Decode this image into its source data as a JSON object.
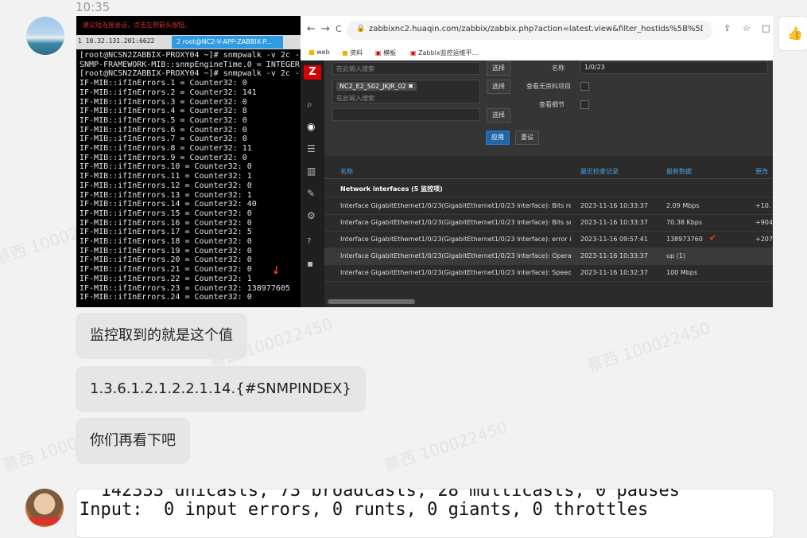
{
  "timestamp": "10:35",
  "terminal": {
    "notice": "建议短连接会话，点击左侧箭头按钮。",
    "tab1": "1 10.32.131.201:6622",
    "tab2": "2 root@NC2-V-APP-ZABBIX-P...",
    "lines": [
      "[root@NCSN2ZABBIX-PROXY04 ~]# snmpwalk -v 2c -c",
      "SNMP-FRAMEWORK-MIB::snmpEngineTime.0 = INTEGER:",
      "[root@NCSN2ZABBIX-PROXY04 ~]# snmpwalk -v 2c -c",
      "IF-MIB::ifInErrors.1 = Counter32: 0",
      "IF-MIB::ifInErrors.2 = Counter32: 141",
      "IF-MIB::ifInErrors.3 = Counter32: 0",
      "IF-MIB::ifInErrors.4 = Counter32: 8",
      "IF-MIB::ifInErrors.5 = Counter32: 0",
      "IF-MIB::ifInErrors.6 = Counter32: 0",
      "IF-MIB::ifInErrors.7 = Counter32: 0",
      "IF-MIB::ifInErrors.8 = Counter32: 11",
      "IF-MIB::ifInErrors.9 = Counter32: 0",
      "IF-MIB::ifInErrors.10 = Counter32: 0",
      "IF-MIB::ifInErrors.11 = Counter32: 1",
      "IF-MIB::ifInErrors.12 = Counter32: 0",
      "IF-MIB::ifInErrors.13 = Counter32: 1",
      "IF-MIB::ifInErrors.14 = Counter32: 40",
      "IF-MIB::ifInErrors.15 = Counter32: 0",
      "IF-MIB::ifInErrors.16 = Counter32: 0",
      "IF-MIB::ifInErrors.17 = Counter32: 5",
      "IF-MIB::ifInErrors.18 = Counter32: 0",
      "IF-MIB::ifInErrors.19 = Counter32: 0",
      "IF-MIB::ifInErrors.20 = Counter32: 0",
      "IF-MIB::ifInErrors.21 = Counter32: 0",
      "IF-MIB::ifInErrors.22 = Counter32: 1",
      "IF-MIB::ifInErrors.23 = Counter32: 138977605",
      "IF-MIB::ifInErrors.24 = Counter32: 0"
    ]
  },
  "browser": {
    "nav_back": "←",
    "nav_forward": "→",
    "nav_reload": "C",
    "lock": "🔒",
    "url": "zabbixnc2.huaqin.com/zabbix/zabbix.php?action=latest.view&filter_hostids%5B%5D=17175...",
    "share": "⇪",
    "star": "☆",
    "extra": "□",
    "bookmarks": [
      "web",
      "资料",
      "模板",
      "Zabbix监控运维平..."
    ]
  },
  "zabbix": {
    "logo": "Z",
    "placeholder1": "在此输入搜索",
    "placeholder2": "在此输入搜索",
    "select_btn": "选择",
    "host_chip": "NC2_E2_S02_JKJR_02 ✖",
    "name_label": "名称",
    "name_value": "1/0/23",
    "show_no_data_label": "查看无资料项目",
    "show_details_label": "查看细节",
    "apply": "应用",
    "reset": "重设",
    "col_name": "名称",
    "col_last_check": "最近检查记录",
    "col_last_value": "最新数据",
    "col_change": "更改",
    "group": "Network interfaces (5 监控项)",
    "rows": [
      {
        "name": "Interface GigabitEthernet1/0/23(GigabitEthernet1/0/23 Interface): Bits received",
        "time": "2023-11-16 10:33:37",
        "value": "2.09 Mbps",
        "change": "+10."
      },
      {
        "name": "Interface GigabitEthernet1/0/23(GigabitEthernet1/0/23 Interface): Bits sent",
        "time": "2023-11-16 10:33:37",
        "value": "70.38 Kbps",
        "change": "+904"
      },
      {
        "name": "Interface GigabitEthernet1/0/23(GigabitEthernet1/0/23 Interface): error in",
        "time": "2023-11-16 09:57:41",
        "value": "138973760",
        "change": "+207"
      },
      {
        "name": "Interface GigabitEthernet1/0/23(GigabitEthernet1/0/23 Interface): Operatio...",
        "time": "2023-11-16 10:33:37",
        "value": "up (1)",
        "change": ""
      },
      {
        "name": "Interface GigabitEthernet1/0/23(GigabitEthernet1/0/23 Interface): Speed",
        "time": "2023-11-16 10:32:37",
        "value": "100 Mbps",
        "change": ""
      }
    ]
  },
  "messages": [
    "监控取到的就是这个值",
    "1.3.6.1.2.1.2.2.1.14.{#SNMPINDEX}",
    "你们再看下吧"
  ],
  "code_snippet": {
    "line1": "  142333 unicasts, 73 broadcasts, 28 multicasts, 0 pauses",
    "line2": "Input:  0 input errors, 0 runts, 0 giants, 0 throttles"
  },
  "watermark": "蔡西 100022450",
  "colors": {
    "accent_red": "#d40000",
    "zabbix_link": "#4aa3e0",
    "bubble": "#e6e6e6"
  },
  "icons": [
    "avatar",
    "thumbs-up-icon",
    "red-arrow-icon",
    "search-icon",
    "eye-icon",
    "list-icon",
    "chart-icon",
    "wrench-icon",
    "gear-icon",
    "help-icon",
    "user-icon"
  ]
}
